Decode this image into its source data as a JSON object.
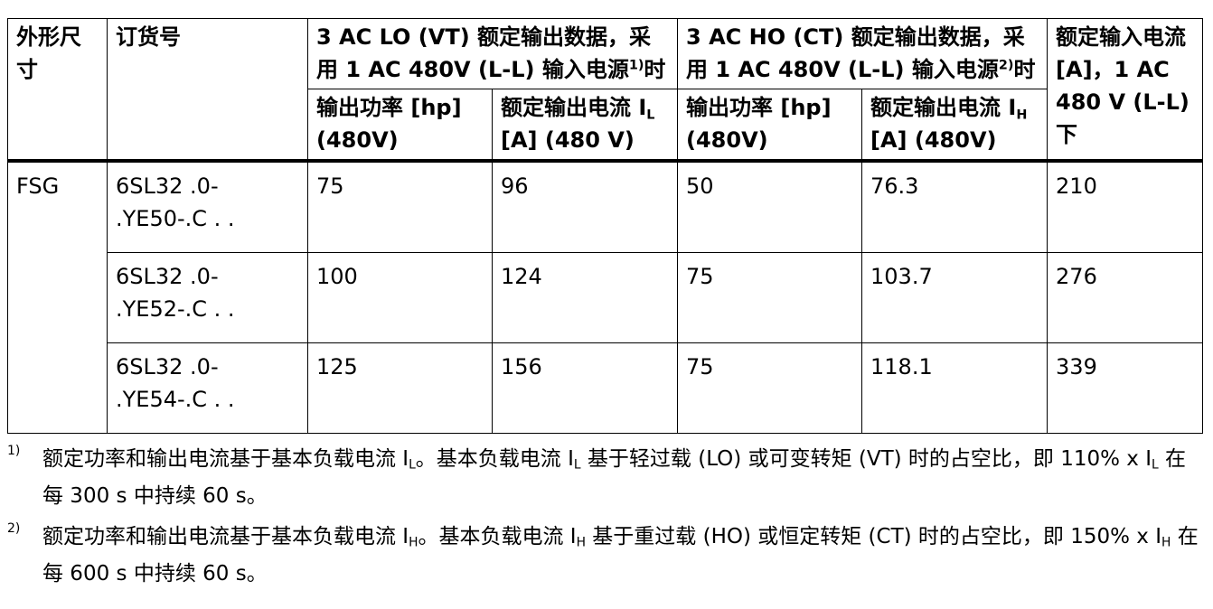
{
  "table": {
    "headers": {
      "size": "外形尺寸",
      "order_number": "订货号",
      "lo_group": {
        "text": "3 AC LO (VT) 额定输出数据，采用 1 AC 480V (L-L) 输入电源",
        "footnote": "1)",
        "tail": "时"
      },
      "ho_group": {
        "text": "3 AC HO (CT) 额定输出数据，采用 1 AC 480V (L-L) 输入电源",
        "footnote": "2)",
        "tail": "时"
      },
      "input_current": "额定输入电流 [A]，1 AC 480 V (L-L) 下",
      "lo_power": "输出功率 [hp] (480V)",
      "lo_current": {
        "pre": "额定输出电流 I",
        "sub": "L",
        "post": " [A] (480 V)"
      },
      "ho_power": "输出功率 [hp] (480V)",
      "ho_current": {
        "pre": "额定输出电流 I",
        "sub": "H",
        "post": " [A] (480V)"
      }
    },
    "size_value": "FSG",
    "rows": [
      {
        "order": "6SL32 .0- .YE50-.C . .",
        "lo_hp": "75",
        "lo_a": "96",
        "ho_hp": "50",
        "ho_a": "76.3",
        "in_a": "210"
      },
      {
        "order": "6SL32 .0- .YE52-.C . .",
        "lo_hp": "100",
        "lo_a": "124",
        "ho_hp": "75",
        "ho_a": "103.7",
        "in_a": "276"
      },
      {
        "order": "6SL32 .0- .YE54-.C . .",
        "lo_hp": "125",
        "lo_a": "156",
        "ho_hp": "75",
        "ho_a": "118.1",
        "in_a": "339"
      }
    ]
  },
  "footnotes": [
    {
      "marker": "1)",
      "p1": "额定功率和输出电流基于基本负载电流 I",
      "s1": "L",
      "p2": "。基本负载电流 I",
      "s2": "L",
      "p3": " 基于轻过载 (LO) 或可变转矩 (VT) 时的占空比，即 110% x I",
      "s3": "L",
      "p4": " 在每 300 s 中持续 60 s。"
    },
    {
      "marker": "2)",
      "p1": "额定功率和输出电流基于基本负载电流 I",
      "s1": "H",
      "p2": "。基本负载电流 I",
      "s2": "H",
      "p3": " 基于重过载 (HO) 或恒定转矩 (CT) 时的占空比，即 150% x I",
      "s3": "H",
      "p4": " 在每 600 s 中持续 60 s。"
    }
  ]
}
